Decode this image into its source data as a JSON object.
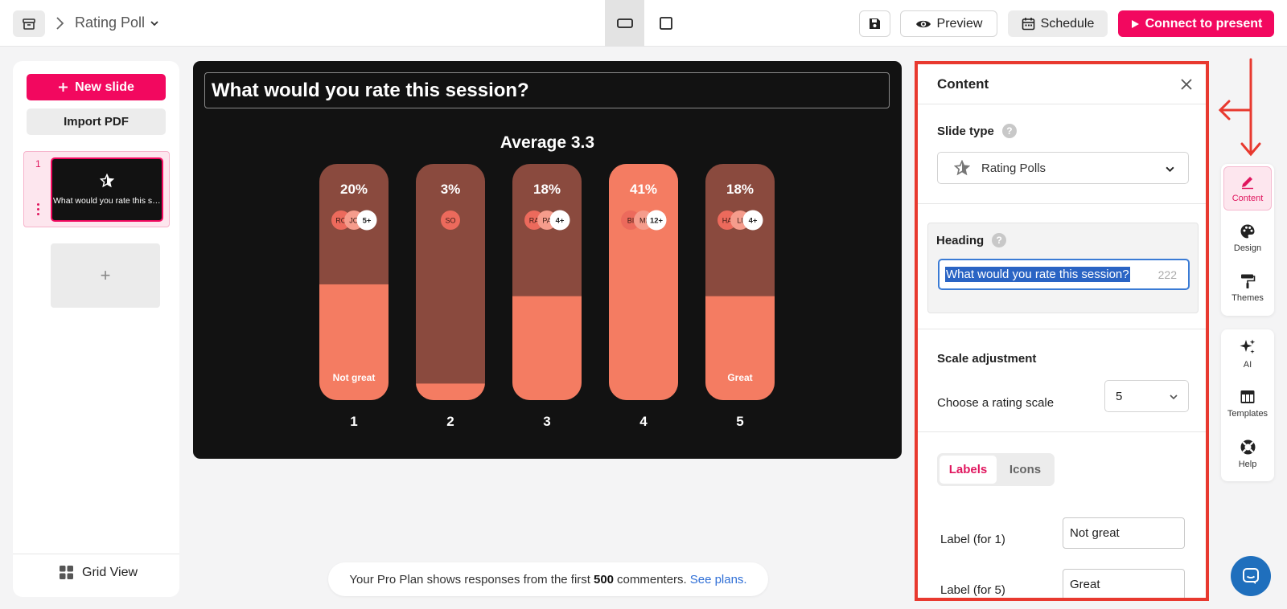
{
  "topbar": {
    "poll_title": "Rating Poll",
    "preview_label": "Preview",
    "schedule_label": "Schedule",
    "connect_label": "Connect to present"
  },
  "sidebar": {
    "new_slide_label": "New slide",
    "import_label": "Import PDF",
    "slides": [
      {
        "number": "1",
        "thumb_text": "What would you rate this session?"
      }
    ],
    "add_label": "+",
    "grid_view_label": "Grid View"
  },
  "canvas": {
    "heading": "What would you rate this session?",
    "average_text": "Average 3.3"
  },
  "chart_data": {
    "type": "bar",
    "categories": [
      "1",
      "2",
      "3",
      "4",
      "5"
    ],
    "values": [
      20,
      3,
      18,
      41,
      18
    ],
    "value_labels": [
      "20%",
      "3%",
      "18%",
      "41%",
      "18%"
    ],
    "bar_labels": [
      "Not great",
      "",
      "",
      "",
      "Great"
    ],
    "fill_fractions": [
      0.49,
      0.07,
      0.44,
      1.0,
      0.44
    ],
    "respondents": [
      {
        "initials": [
          "RO",
          "JO"
        ],
        "more": "5+"
      },
      {
        "initials": [
          "SO"
        ],
        "more": ""
      },
      {
        "initials": [
          "RA",
          "PA"
        ],
        "more": "4+"
      },
      {
        "initials": [
          "BI",
          "MI"
        ],
        "more": "12+"
      },
      {
        "initials": [
          "HA",
          "LI"
        ],
        "more": "4+"
      }
    ],
    "colors": {
      "track": "#8a4a3e",
      "fill": "#f47c62",
      "avatar1": "#ec6a5c",
      "avatar2": "#f59c8c"
    }
  },
  "notice": {
    "text_before": "Your Pro Plan shows responses from the first",
    "count": "500",
    "text_after": "commenters.",
    "link": "See plans."
  },
  "content_panel": {
    "title": "Content",
    "slide_type_label": "Slide type",
    "slide_type_value": "Rating Polls",
    "heading_label": "Heading",
    "heading_value": "What would you rate this session?",
    "heading_count": "222",
    "scale_section_label": "Scale adjustment",
    "scale_label": "Choose a rating scale",
    "scale_value": "5",
    "tab_labels": "Labels",
    "tab_icons": "Icons",
    "label_1_text": "Label (for 1)",
    "label_1_value": "Not great",
    "label_5_text": "Label (for 5)",
    "label_5_value": "Great"
  },
  "rail": {
    "content": "Content",
    "design": "Design",
    "themes": "Themes",
    "ai": "AI",
    "templates": "Templates",
    "help": "Help"
  },
  "colors": {
    "brand": "#f2085f",
    "highlight_border": "#e8392f"
  }
}
